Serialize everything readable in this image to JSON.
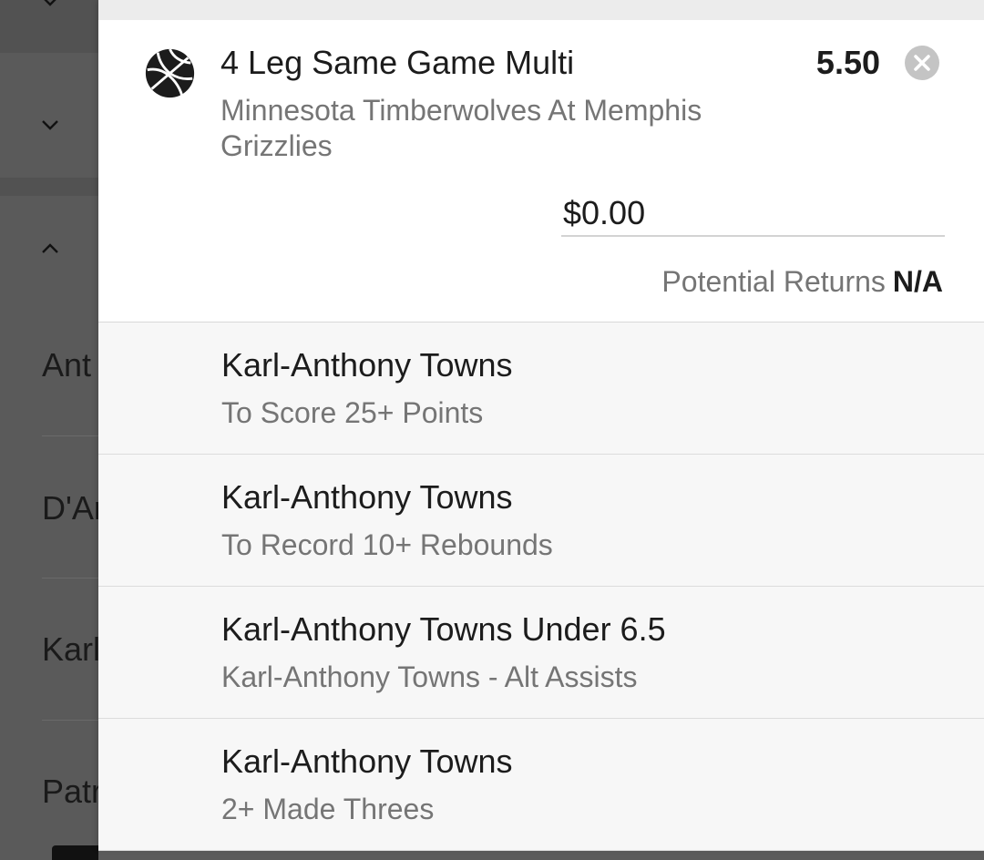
{
  "background_page": {
    "row_texts": [
      "Ant",
      "D'Ar",
      "Karl",
      "Patr"
    ]
  },
  "bet": {
    "title": "4 Leg Same Game Multi",
    "odds": "5.50",
    "event": "Minnesota Timberwolves At Memphis Grizzlies",
    "stake_value": "$0.00",
    "potential_returns_label": "Potential Returns",
    "potential_returns_value": "N/A",
    "icon": "basketball-icon"
  },
  "legs": [
    {
      "title": "Karl-Anthony Towns",
      "subtitle": "To Score 25+ Points"
    },
    {
      "title": "Karl-Anthony Towns",
      "subtitle": "To Record 10+ Rebounds"
    },
    {
      "title": "Karl-Anthony Towns Under 6.5",
      "subtitle": "Karl-Anthony Towns - Alt Assists"
    },
    {
      "title": "Karl-Anthony Towns",
      "subtitle": "2+ Made Threes"
    }
  ],
  "colors": {
    "overlay": "#5a5a5a",
    "panel_bg": "#ffffff",
    "leg_bg": "#f7f7f7",
    "text_primary": "#1c1c1c",
    "text_secondary": "#757575",
    "close_button": "#c4c4c4"
  }
}
